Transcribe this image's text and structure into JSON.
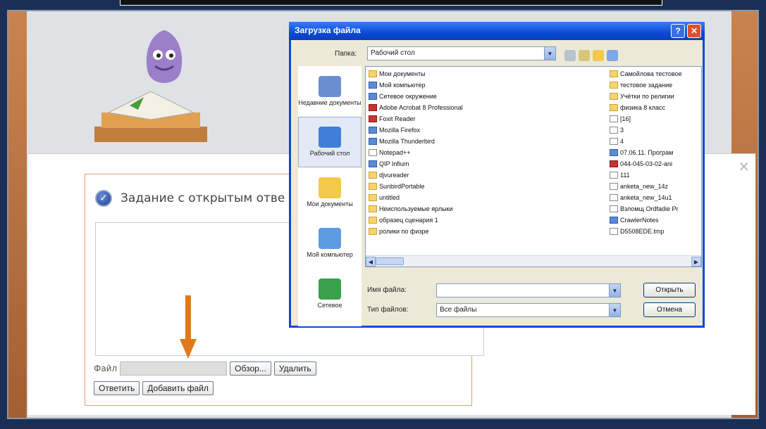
{
  "page": {
    "task_title": "Задание с открытым отве",
    "file_label": "Файл",
    "browse_btn": "Обзор...",
    "delete_btn": "Удалить",
    "answer_btn": "Ответить",
    "add_file_btn": "Добавить файл",
    "close_glyph": "✕"
  },
  "dialog": {
    "title": "Загрузка файла",
    "help_glyph": "?",
    "close_glyph": "✕",
    "folder_label": "Папка:",
    "folder_value": "Рабочий стол",
    "places": [
      {
        "label": "Недавние документы",
        "icon": "recent-documents-icon",
        "color": "#6a8fd0"
      },
      {
        "label": "Рабочий стол",
        "icon": "desktop-icon",
        "color": "#3f7fd8",
        "selected": true
      },
      {
        "label": "Мои документы",
        "icon": "my-documents-icon",
        "color": "#f2c94c"
      },
      {
        "label": "Мой компьютер",
        "icon": "my-computer-icon",
        "color": "#5d9be0"
      },
      {
        "label": "Сетевое",
        "icon": "network-icon",
        "color": "#3aa04a"
      }
    ],
    "files_left": [
      {
        "name": "Мои документы",
        "type": "folder"
      },
      {
        "name": "Мой компьютер",
        "type": "app"
      },
      {
        "name": "Сетевое окружение",
        "type": "app"
      },
      {
        "name": "Adobe Acrobat 8 Professional",
        "type": "red"
      },
      {
        "name": "Foxit Reader",
        "type": "red"
      },
      {
        "name": "Mozilla Firefox",
        "type": "app"
      },
      {
        "name": "Mozilla Thunderbird",
        "type": "app"
      },
      {
        "name": "Notepad++",
        "type": "doc"
      },
      {
        "name": "QIP Infium",
        "type": "app"
      },
      {
        "name": "djvureader",
        "type": "folder"
      },
      {
        "name": "SunbirdPortable",
        "type": "folder"
      },
      {
        "name": "untitled",
        "type": "folder"
      },
      {
        "name": "Неиспользуемые ярлыки",
        "type": "folder"
      },
      {
        "name": "образец сценария 1",
        "type": "folder"
      },
      {
        "name": "ролики по физре",
        "type": "folder"
      }
    ],
    "files_right": [
      {
        "name": "Самойлова тестовое",
        "type": "folder"
      },
      {
        "name": "тестовое задание",
        "type": "folder"
      },
      {
        "name": "Учётки по религии",
        "type": "folder"
      },
      {
        "name": "физика 8 класс",
        "type": "folder"
      },
      {
        "name": "[16]",
        "type": "doc"
      },
      {
        "name": "3",
        "type": "doc"
      },
      {
        "name": "4",
        "type": "doc"
      },
      {
        "name": "07.06.11. Програм",
        "type": "app"
      },
      {
        "name": "044-045-03-02-ani",
        "type": "red"
      },
      {
        "name": "111",
        "type": "doc"
      },
      {
        "name": "anketa_new_14z",
        "type": "doc"
      },
      {
        "name": "anketa_new_14u1",
        "type": "doc"
      },
      {
        "name": "Взломщ Ordfadie Pr",
        "type": "doc"
      },
      {
        "name": "CrawlerNotes",
        "type": "app"
      },
      {
        "name": "D5508EDE.tmp",
        "type": "doc"
      }
    ],
    "filename_label": "Имя файла:",
    "filename_value": "",
    "filetype_label": "Тип файлов:",
    "filetype_value": "Все файлы",
    "open_btn": "Открыть",
    "cancel_btn": "Отмена"
  },
  "colors": {
    "accent_arrow": "#e07a1c",
    "titlebar": "#0a4bd6",
    "task_border": "#e8a070"
  }
}
